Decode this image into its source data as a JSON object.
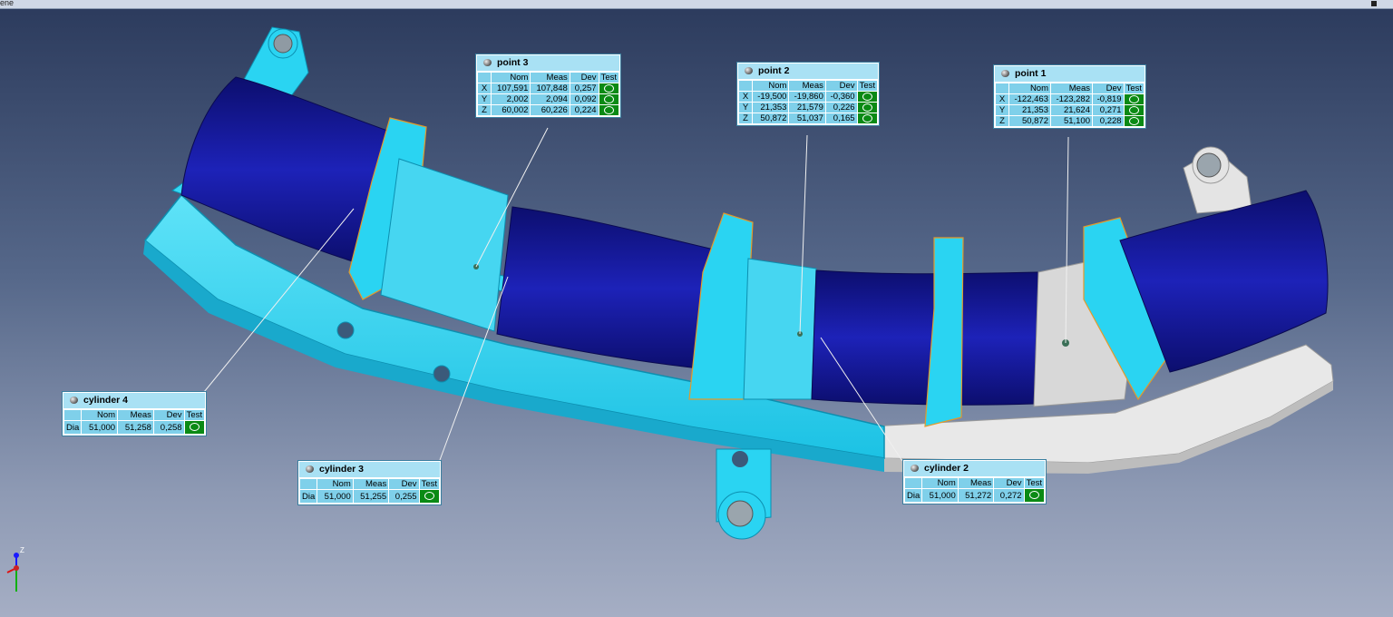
{
  "window": {
    "title": "ene"
  },
  "axis": {
    "z_label": "Z"
  },
  "callouts": {
    "point3": {
      "title": "point 3",
      "headers": [
        "Nom",
        "Meas",
        "Dev",
        "Test"
      ],
      "rows": [
        {
          "axis": "X",
          "nom": "107,591",
          "meas": "107,848",
          "dev": "0,257"
        },
        {
          "axis": "Y",
          "nom": "2,002",
          "meas": "2,094",
          "dev": "0,092"
        },
        {
          "axis": "Z",
          "nom": "60,002",
          "meas": "60,226",
          "dev": "0,224"
        }
      ]
    },
    "point2": {
      "title": "point 2",
      "headers": [
        "Nom",
        "Meas",
        "Dev",
        "Test"
      ],
      "rows": [
        {
          "axis": "X",
          "nom": "-19,500",
          "meas": "-19,860",
          "dev": "-0,360"
        },
        {
          "axis": "Y",
          "nom": "21,353",
          "meas": "21,579",
          "dev": "0,226"
        },
        {
          "axis": "Z",
          "nom": "50,872",
          "meas": "51,037",
          "dev": "0,165"
        }
      ]
    },
    "point1": {
      "title": "point 1",
      "headers": [
        "Nom",
        "Meas",
        "Dev",
        "Test"
      ],
      "rows": [
        {
          "axis": "X",
          "nom": "-122,463",
          "meas": "-123,282",
          "dev": "-0,819"
        },
        {
          "axis": "Y",
          "nom": "21,353",
          "meas": "21,624",
          "dev": "0,271"
        },
        {
          "axis": "Z",
          "nom": "50,872",
          "meas": "51,100",
          "dev": "0,228"
        }
      ]
    },
    "cylinder4": {
      "title": "cylinder 4",
      "headers": [
        "Nom",
        "Meas",
        "Dev",
        "Test"
      ],
      "rows": [
        {
          "axis": "Dia",
          "nom": "51,000",
          "meas": "51,258",
          "dev": "0,258"
        }
      ]
    },
    "cylinder3": {
      "title": "cylinder 3",
      "headers": [
        "Nom",
        "Meas",
        "Dev",
        "Test"
      ],
      "rows": [
        {
          "axis": "Dia",
          "nom": "51,000",
          "meas": "51,255",
          "dev": "0,255"
        }
      ]
    },
    "cylinder2": {
      "title": "cylinder 2",
      "headers": [
        "Nom",
        "Meas",
        "Dev",
        "Test"
      ],
      "rows": [
        {
          "axis": "Dia",
          "nom": "51,000",
          "meas": "51,272",
          "dev": "0,272"
        }
      ]
    }
  },
  "colors": {
    "fixture": "#2ad4f2",
    "fixture_edge": "#0c8fb0",
    "pipe": "#12148f",
    "pipe_highlight": "#2226c6",
    "gray_part": "#d9d9d9",
    "orange_edge": "#e39a2a",
    "pass_green": "#0a8a14",
    "callout_bg": "#7fd0ea"
  },
  "icons": {
    "pass": "circle-pass-icon",
    "sphere": "sphere-bullet-icon"
  }
}
